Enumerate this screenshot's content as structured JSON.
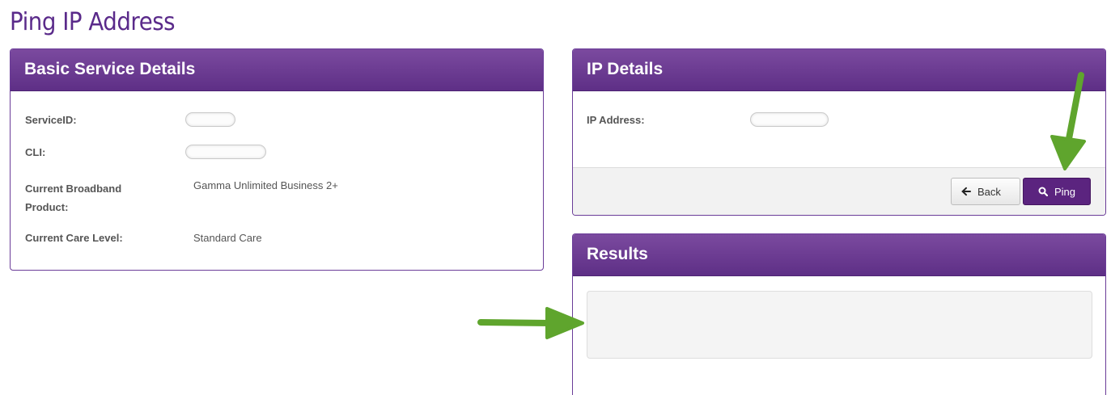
{
  "page": {
    "title": "Ping IP Address"
  },
  "basic_service": {
    "heading": "Basic Service Details",
    "rows": [
      {
        "label": "ServiceID:",
        "value": ""
      },
      {
        "label": "CLI:",
        "value": ""
      },
      {
        "label": "Current Broadband",
        "label_line2": "Product:",
        "value": "Gamma Unlimited Business 2+"
      },
      {
        "label": "Current Care Level:",
        "value": "Standard Care"
      }
    ]
  },
  "ip_details": {
    "heading": "IP Details",
    "ip_label": "IP Address:",
    "back_label": "Back",
    "ping_label": "Ping"
  },
  "results": {
    "heading": "Results",
    "output": ""
  },
  "colors": {
    "brand_purple": "#5b247f",
    "annotation_arrow": "#5fa52d"
  },
  "icons": {
    "back": "arrow-left-icon",
    "ping": "search-icon"
  }
}
